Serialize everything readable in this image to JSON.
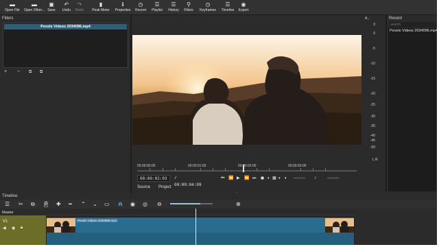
{
  "toolbar": {
    "items": [
      {
        "label": "Open File",
        "icon": "folder-open-icon",
        "glyph": "▬"
      },
      {
        "label": "Open Other...",
        "icon": "folder-other-icon",
        "glyph": "▬"
      },
      {
        "label": "Save",
        "icon": "save-icon",
        "glyph": "▣"
      },
      {
        "label": "Undo",
        "icon": "undo-icon",
        "glyph": "↶"
      },
      {
        "label": "Redo",
        "icon": "redo-icon",
        "glyph": "↷"
      },
      {
        "label": "Peak Meter",
        "icon": "peak-meter-icon",
        "glyph": "▮"
      },
      {
        "label": "Properties",
        "icon": "properties-icon",
        "glyph": "ℹ"
      },
      {
        "label": "Recent",
        "icon": "recent-icon",
        "glyph": "◷"
      },
      {
        "label": "Playlist",
        "icon": "playlist-icon",
        "glyph": "☰"
      },
      {
        "label": "History",
        "icon": "history-icon",
        "glyph": "☰"
      },
      {
        "label": "Filters",
        "icon": "filters-icon",
        "glyph": "⚲"
      },
      {
        "label": "Keyframes",
        "icon": "keyframes-icon",
        "glyph": "◷"
      },
      {
        "label": "Timeline",
        "icon": "timeline-icon",
        "glyph": "☰"
      },
      {
        "label": "Export",
        "icon": "export-icon",
        "glyph": "◉"
      }
    ]
  },
  "filters": {
    "title": "Filters",
    "clip_name": "Pexels Videos 2034096.mp4"
  },
  "meter": {
    "header": "A...",
    "ticks": [
      "3",
      "0",
      "-5",
      "-10",
      "-15",
      "-20",
      "-25",
      "-30",
      "-35",
      "-40",
      "-45",
      "-50"
    ],
    "footer": "L R"
  },
  "recent": {
    "title": "Recent",
    "search_placeholder": "search",
    "items": [
      "Pexels Videos 2034096.mp4"
    ]
  },
  "scrubber": {
    "labels": [
      "00:00:00:00",
      "00:00:01:00",
      "00:00:02:00",
      "00:00:03:00"
    ]
  },
  "transport": {
    "position": "00:00:02:03",
    "duration": "/ 00:00:04:09",
    "in_point": "--:--:--:--",
    "separator": "/",
    "out_point": "--:--:--:--"
  },
  "tabs": {
    "source": "Source",
    "project": "Project"
  },
  "timeline": {
    "title": "Timeline",
    "master_label": "Master",
    "track_label": "V1",
    "clip_label": "Pexels Videos 2034096.mp4"
  },
  "colors": {
    "accent": "#2c5f7c",
    "clip": "#2a6c8e",
    "track_head": "#6d6d2a"
  }
}
